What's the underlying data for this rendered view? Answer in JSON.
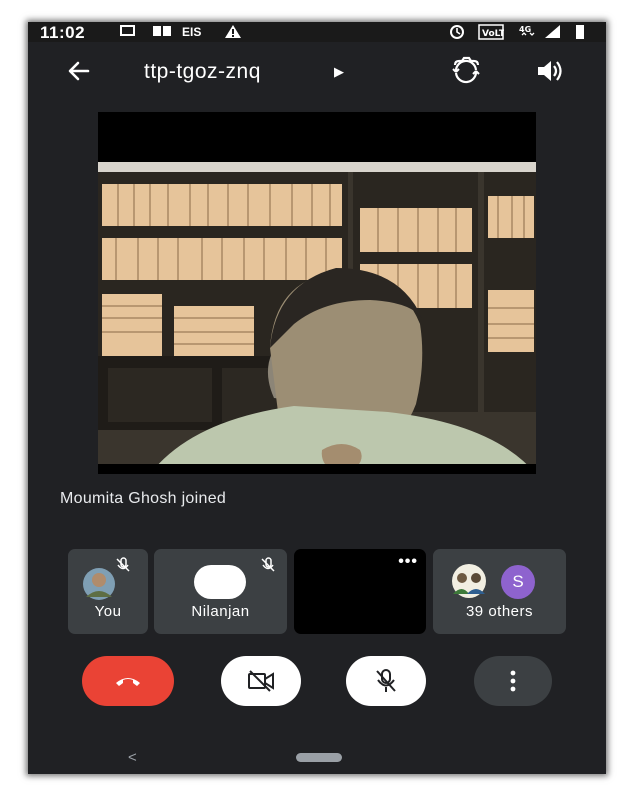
{
  "status_bar": {
    "time": "11:02",
    "carrier": "EIS",
    "icons": [
      "cast-icon",
      "book-icon",
      "warning-icon",
      "alarm-icon",
      "volte-icon",
      "4g-signal-icon",
      "signal-icon",
      "battery-icon"
    ]
  },
  "header": {
    "meeting_code": "ttp-tgoz-znq",
    "back_icon": "arrow-left-icon",
    "switch_camera_icon": "switch-camera-icon",
    "audio_icon": "speaker-icon"
  },
  "notification": {
    "text": "Moumita Ghosh joined"
  },
  "participants": [
    {
      "name": "You",
      "muted": true,
      "avatar": "photo"
    },
    {
      "name": "Nilanjan",
      "muted": true,
      "avatar": "white-circle"
    },
    {
      "name": "",
      "menu_icon": "more-horiz-icon"
    },
    {
      "name": "39 others",
      "avatar_letter": "S",
      "avatar_color": "#8e63ce"
    }
  ],
  "controls": {
    "end_call": {
      "icon": "call-end-icon",
      "color": "#ea4335"
    },
    "camera": {
      "icon": "videocam-off-icon"
    },
    "mic": {
      "icon": "mic-off-icon"
    },
    "more": {
      "icon": "more-vert-icon"
    }
  },
  "navigation": {
    "back_glyph": "<"
  },
  "colors": {
    "background": "#202124",
    "tile": "#3c4043",
    "end_call": "#ea4335",
    "avatar_s": "#8e63ce"
  }
}
